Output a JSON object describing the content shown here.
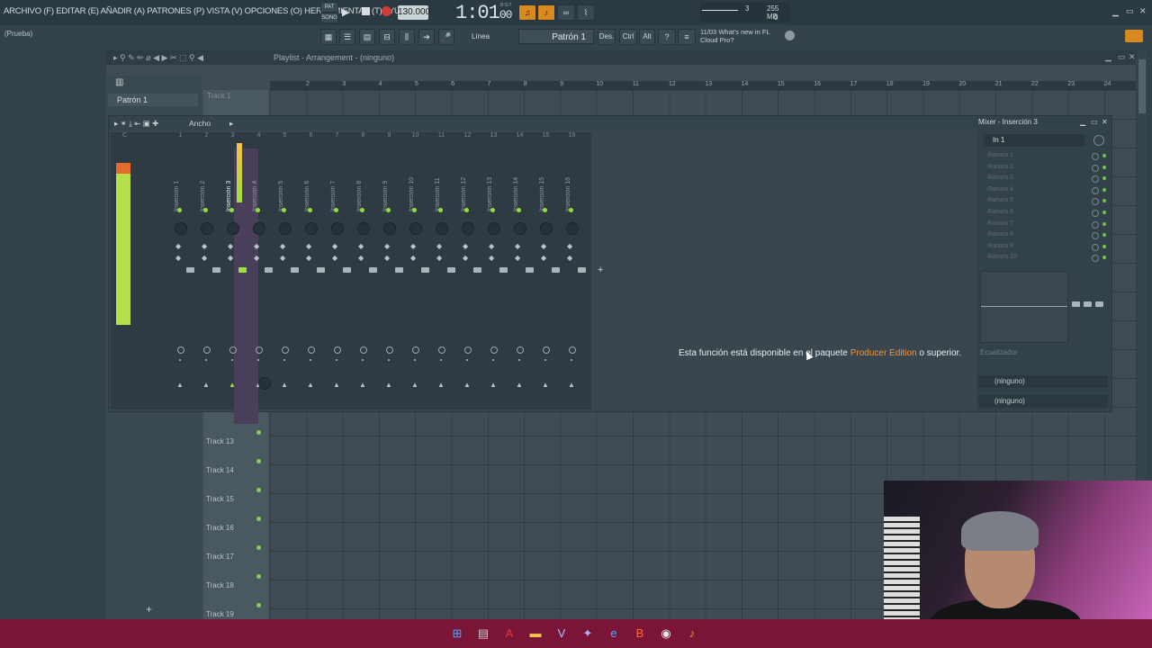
{
  "menubar": {
    "text": "ARCHIVO (F) EDITAR (E) AÑADIR (A) PATRONES (P) VISTA (V) OPCIONES (O) HERRAMIENTAS (T) AYUDA"
  },
  "transport": {
    "pat_label": "PAT",
    "song_label": "SONG",
    "tempo": "130.000",
    "time": "1:01",
    "time_sub": "00",
    "time_unit": "B:S:T",
    "cpu_count": "3",
    "memory": "255 MB",
    "voices": "0"
  },
  "hint": {
    "project_name": "(Prueba)"
  },
  "toolbar": {
    "snap_label": "Línea",
    "pattern": "Patrón 1",
    "des_label": "Des.",
    "ctrl_label": "Ctrl",
    "alt_label": "Alt"
  },
  "news": {
    "date": "11/03",
    "line1": "What's new in FL",
    "line2": "Cloud Pro?"
  },
  "playlist": {
    "title": "Playlist - Arrangement - (ninguno)",
    "pattern_item": "Patrón 1",
    "track_top": "Track 1",
    "ruler": [
      "2",
      "3",
      "4",
      "5",
      "6",
      "7",
      "8",
      "9",
      "10",
      "11",
      "12",
      "13",
      "14",
      "15",
      "16",
      "17",
      "18",
      "19",
      "20",
      "21",
      "22",
      "23",
      "24"
    ],
    "tracks": [
      "Track 13",
      "Track 14",
      "Track 15",
      "Track 16",
      "Track 17",
      "Track 18",
      "Track 19"
    ],
    "add_symbol": "+"
  },
  "mixer": {
    "title_mode": "Ancho",
    "panel_title": "Mixer - Inserción 3",
    "input": "In 1",
    "strips": [
      {
        "num": "C",
        "name": "Master"
      },
      {
        "num": "1",
        "name": "Inserción 1"
      },
      {
        "num": "2",
        "name": "Inserción 2"
      },
      {
        "num": "3",
        "name": "Inserción 3"
      },
      {
        "num": "4",
        "name": "Inserción 4"
      },
      {
        "num": "5",
        "name": "Inserción 5"
      },
      {
        "num": "6",
        "name": "Inserción 6"
      },
      {
        "num": "7",
        "name": "Inserción 7"
      },
      {
        "num": "8",
        "name": "Inserción 8"
      },
      {
        "num": "9",
        "name": "Inserción 9"
      },
      {
        "num": "10",
        "name": "Inserción 10"
      },
      {
        "num": "11",
        "name": "Inserción 11"
      },
      {
        "num": "12",
        "name": "Inserción 12"
      },
      {
        "num": "13",
        "name": "Inserción 13"
      },
      {
        "num": "14",
        "name": "Inserción 14"
      },
      {
        "num": "15",
        "name": "Inserción 15"
      },
      {
        "num": "16",
        "name": "Inserción 16"
      }
    ],
    "slots": [
      "Ranura 1",
      "Ranura 2",
      "Ranura 3",
      "Ranura 4",
      "Ranura 5",
      "Ranura 6",
      "Ranura 7",
      "Ranura 8",
      "Ranura 9",
      "Ranura 10"
    ],
    "eq_label": "Ecualizador",
    "route1": "(ninguno)",
    "route2": "(ninguno)",
    "notice_before": "Esta función está disponible en el paquete ",
    "notice_highlight": "Producer Edition",
    "notice_after": " o superior."
  },
  "colors": {
    "accent_orange": "#f0953a",
    "meter_green": "#9fe03c",
    "taskbar": "#7a1537"
  },
  "taskbar_icons": [
    "windows-icon",
    "file-icon",
    "acrobat-icon",
    "folder-icon",
    "visual-studio-icon",
    "puzzle-icon",
    "edge-icon",
    "brave-icon",
    "chrome-icon",
    "fl-studio-icon"
  ]
}
